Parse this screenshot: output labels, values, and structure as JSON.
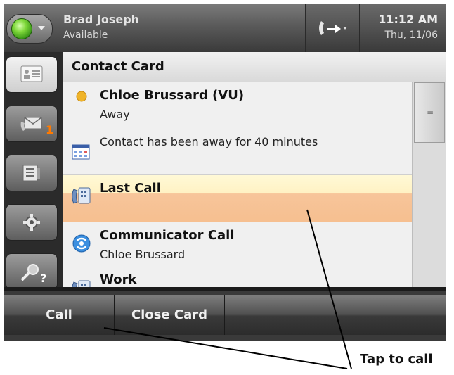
{
  "status_bar": {
    "user_name": "Brad Joseph",
    "user_status": "Available",
    "time": "11:12 AM",
    "date": "Thu, 11/06",
    "presence_color": "#4caf1f"
  },
  "nav": {
    "items": [
      {
        "icon": "contact-card-icon",
        "active": true
      },
      {
        "icon": "voicemail-icon",
        "badge": "1"
      },
      {
        "icon": "call-log-icon"
      },
      {
        "icon": "gear-icon"
      },
      {
        "icon": "search-help-icon"
      }
    ]
  },
  "panel": {
    "title": "Contact Card",
    "contact": {
      "name": "Chloe Brussard (VU)",
      "presence": "Away",
      "presence_color": "#f0b429"
    },
    "away_note": "Contact has been away for 40 minutes",
    "last_call": {
      "label": "Last Call"
    },
    "communicator_call": {
      "label": "Communicator Call",
      "detail": "Chloe Brussard"
    },
    "work": {
      "label": "Work"
    }
  },
  "softkeys": {
    "call": "Call",
    "close_card": "Close Card"
  },
  "annotation": {
    "text": "Tap to call"
  }
}
